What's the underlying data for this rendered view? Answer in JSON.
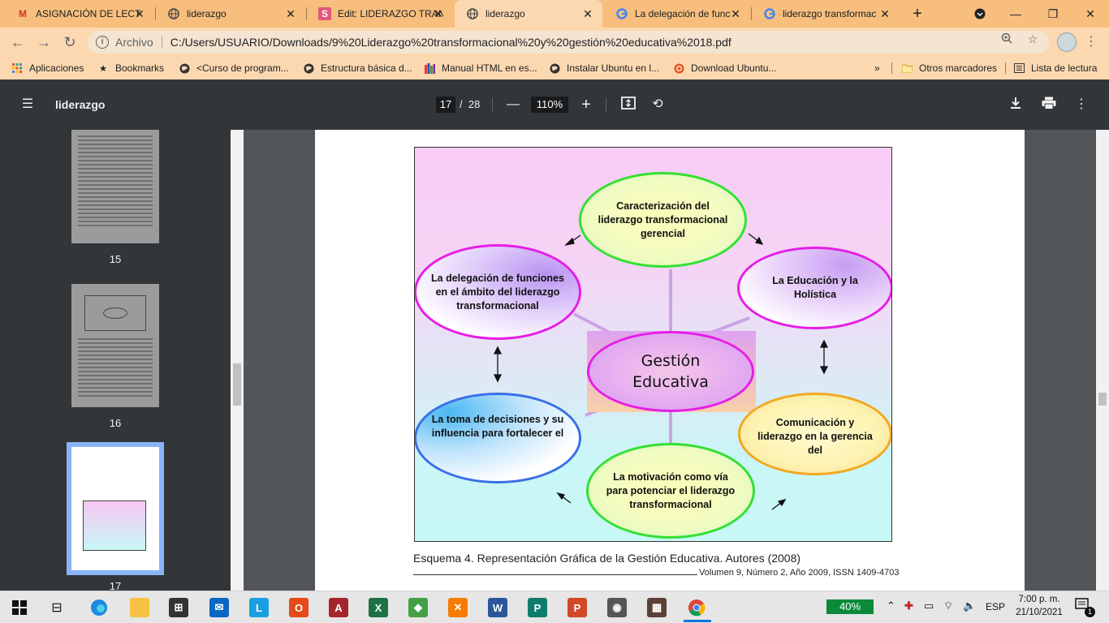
{
  "tabs": [
    {
      "label": "ASIGNACIÓN DE LECT",
      "icon": "gmail-icon"
    },
    {
      "label": "liderazgo",
      "icon": "globe-icon"
    },
    {
      "label": "Edit: LIDERAZGO TRAN",
      "icon": "edit-site-icon"
    },
    {
      "label": "liderazgo",
      "icon": "globe-icon"
    },
    {
      "label": "La delegación de func",
      "icon": "google-icon"
    },
    {
      "label": "liderazgo transformac",
      "icon": "google-icon"
    }
  ],
  "address": {
    "label": "Archivo",
    "url": "C:/Users/USUARIO/Downloads/9%20Liderazgo%20transformacional%20y%20gestión%20educativa%2018.pdf"
  },
  "bookmarks": [
    "Aplicaciones",
    "Bookmarks",
    "<Curso de program...",
    "Estructura básica d...",
    "Manual HTML en es...",
    "Instalar Ubuntu en l...",
    "Download Ubuntu...",
    "Otros marcadores",
    "Lista de lectura"
  ],
  "pdf": {
    "title": "liderazgo",
    "current_page": "17",
    "page_separator": "/",
    "total_pages": "28",
    "zoom": "110%"
  },
  "thumbnails": [
    "15",
    "16",
    "17"
  ],
  "diagram": {
    "center": "Gestión Educativa",
    "nodes": [
      "Caracterización del liderazgo transformacional gerencial",
      "La Educación y la Holística",
      "Comunicación y liderazgo en la gerencia del",
      "La motivación como vía para potenciar el liderazgo transformacional",
      "La toma de decisiones y su influencia para fortalecer el",
      "La delegación de funciones en el ámbito del liderazgo transformacional"
    ]
  },
  "caption": "Esquema 4. Representación Gráfica de la Gestión Educativa. Autores (2008)",
  "footer": "Volumen  9,  Número 2, Año 2009, ISSN 1409-4703",
  "taskbar": {
    "battery": "40%",
    "language": "ESP",
    "time": "7:00 p. m.",
    "date": "21/10/2021",
    "notifications": "1"
  }
}
